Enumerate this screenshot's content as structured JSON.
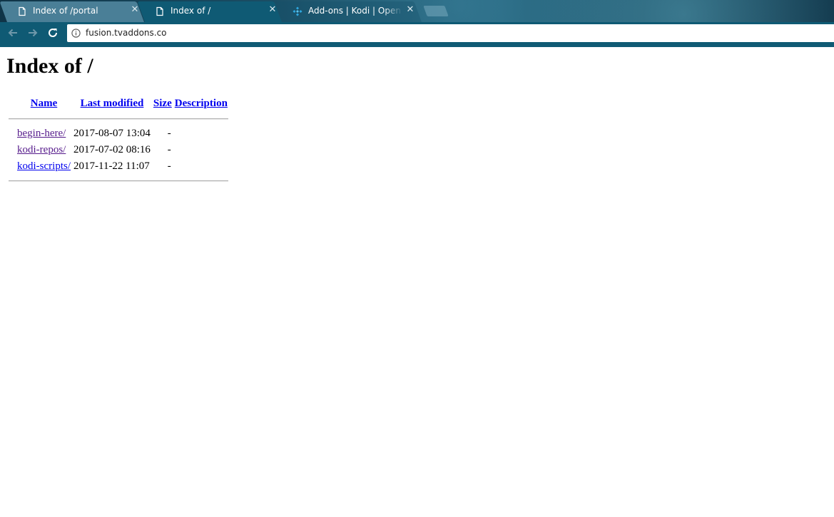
{
  "browser": {
    "tabs": [
      {
        "title": "Index of /portal",
        "icon": "document-icon",
        "state": "inactive"
      },
      {
        "title": "Index of /",
        "icon": "document-icon",
        "state": "active"
      },
      {
        "title": "Add-ons | Kodi | Open Source Home Theater Software",
        "icon": "kodi-logo-icon",
        "state": "inactive"
      }
    ],
    "close_glyph": "✕",
    "address_bar": {
      "url": "fusion.tvaddons.co"
    }
  },
  "page": {
    "title": "Index of /",
    "columns": {
      "name": "Name",
      "last_modified": "Last modified",
      "size": "Size",
      "description": "Description"
    },
    "entries": [
      {
        "name": "begin-here/",
        "last_modified": "2017-08-07 13:04",
        "size": "-",
        "description": "",
        "visited": true
      },
      {
        "name": "kodi-repos/",
        "last_modified": "2017-07-02 08:16",
        "size": "-",
        "description": "",
        "visited": true
      },
      {
        "name": "kodi-scripts/",
        "last_modified": "2017-11-22 11:07",
        "size": "-",
        "description": "",
        "visited": false
      }
    ]
  },
  "colors": {
    "tab_active": "#0f5a74",
    "tab_inactive": "#4a7f97",
    "link": "#0000ee",
    "link_visited": "#551a8b"
  }
}
